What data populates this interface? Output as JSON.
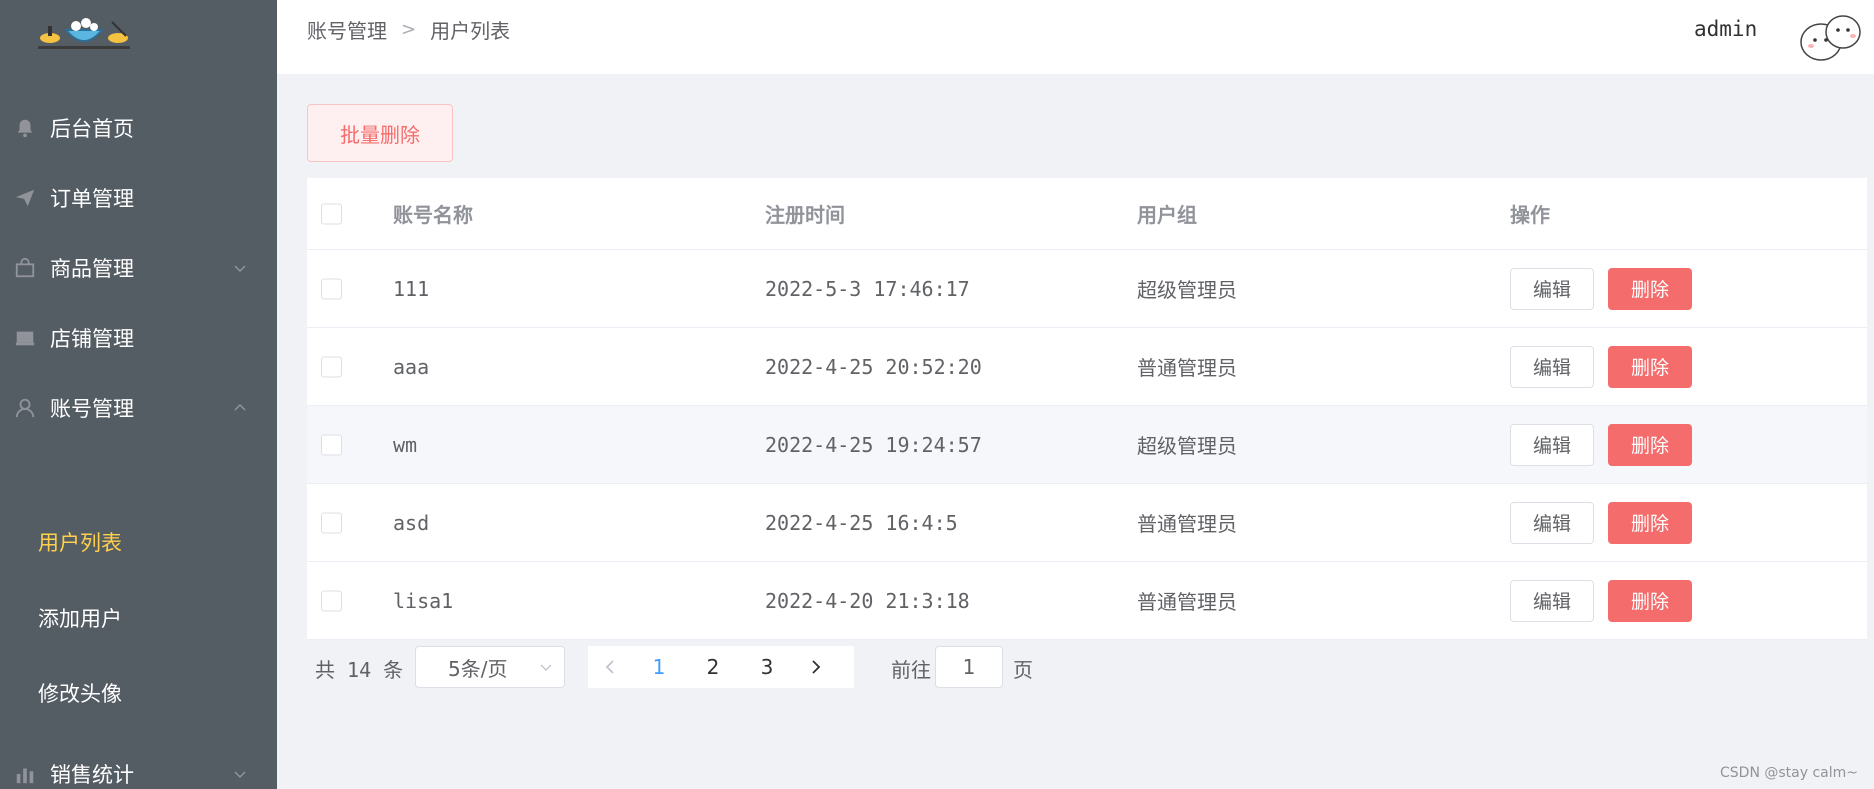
{
  "sidebar": {
    "menu": [
      {
        "label": "后台首页",
        "icon": "bell-icon"
      },
      {
        "label": "订单管理",
        "icon": "paper-plane-icon"
      },
      {
        "label": "商品管理",
        "icon": "shopping-bag-icon",
        "expandable": true
      },
      {
        "label": "店铺管理",
        "icon": "shop-icon"
      },
      {
        "label": "账号管理",
        "icon": "user-icon",
        "expanded": true
      },
      {
        "label": "销售统计",
        "icon": "bar-chart-icon",
        "expandable": true
      }
    ],
    "submenu": [
      {
        "label": "用户列表",
        "active": true
      },
      {
        "label": "添加用户"
      },
      {
        "label": "修改头像"
      }
    ]
  },
  "header": {
    "breadcrumb": [
      "账号管理",
      "用户列表"
    ],
    "username": "admin"
  },
  "actions": {
    "bulk_delete": "批量删除"
  },
  "table": {
    "columns": [
      "账号名称",
      "注册时间",
      "用户组",
      "操作"
    ],
    "rows": [
      {
        "name": "111",
        "time": "2022-5-3 17:46:17",
        "group": "超级管理员"
      },
      {
        "name": "aaa",
        "time": "2022-4-25 20:52:20",
        "group": "普通管理员"
      },
      {
        "name": "wm",
        "time": "2022-4-25 19:24:57",
        "group": "超级管理员"
      },
      {
        "name": "asd",
        "time": "2022-4-25 16:4:5",
        "group": "普通管理员"
      },
      {
        "name": "lisa1",
        "time": "2022-4-20 21:3:18",
        "group": "普通管理员"
      }
    ],
    "edit_label": "编辑",
    "delete_label": "删除"
  },
  "pagination": {
    "total_text": "共 14 条",
    "page_size": "5条/页",
    "pages": [
      "1",
      "2",
      "3"
    ],
    "current_page": "1",
    "goto_label": "前往",
    "goto_value": "1",
    "page_suffix": "页"
  },
  "watermark": "CSDN @stay calm~",
  "colors": {
    "sidebar_bg": "#545c64",
    "active_menu": "#ffd04b",
    "danger": "#f56c6c",
    "primary": "#409eff"
  }
}
